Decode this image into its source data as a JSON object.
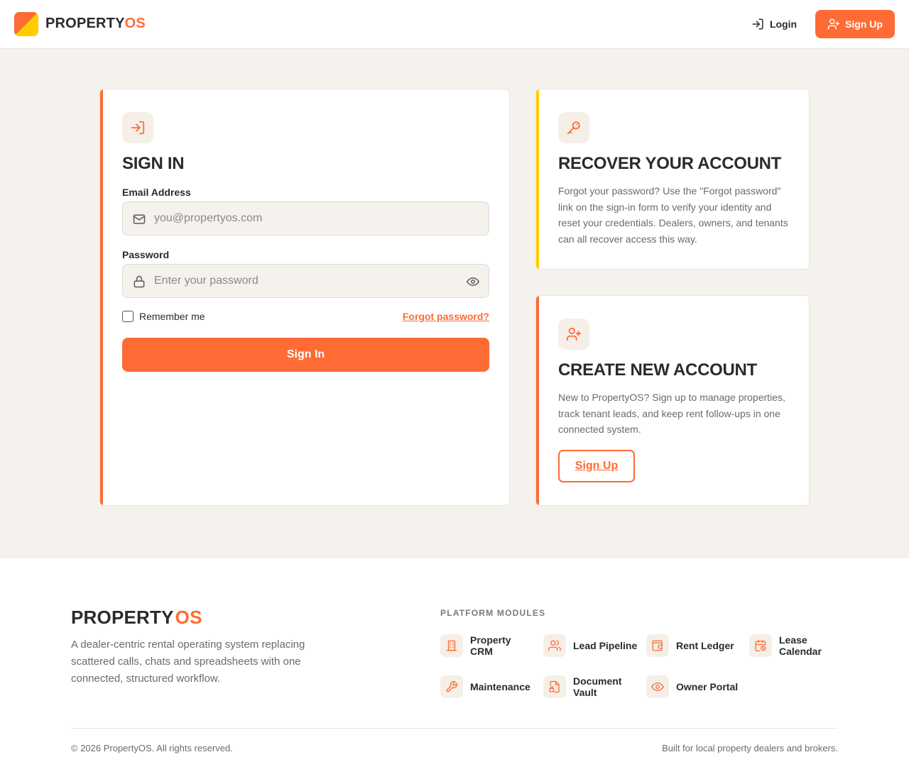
{
  "header": {
    "logo_primary": "PROPERTY",
    "logo_accent": "OS",
    "login_label": "Login",
    "signup_label": "Sign Up"
  },
  "signin": {
    "title": "SIGN IN",
    "email_label": "Email Address",
    "email_placeholder": "you@propertyos.com",
    "password_label": "Password",
    "password_placeholder": "Enter your password",
    "remember_label": "Remember me",
    "forgot_label": "Forgot password?",
    "submit_label": "Sign In"
  },
  "recover": {
    "title": "RECOVER YOUR ACCOUNT",
    "text": "Forgot your password? Use the \"Forgot password\" link on the sign-in form to verify your identity and reset your credentials. Dealers, owners, and tenants can all recover access this way."
  },
  "create": {
    "title": "CREATE NEW ACCOUNT",
    "text": "New to PropertyOS? Sign up to manage properties, track tenant leads, and keep rent follow-ups in one connected system.",
    "button_label": "Sign Up"
  },
  "footer": {
    "logo_primary": "PROPERTY",
    "logo_accent": "OS",
    "description": "A dealer-centric rental operating system replacing scattered calls, chats and spreadsheets with one connected, structured workflow.",
    "modules_heading": "PLATFORM MODULES",
    "modules": [
      {
        "label": "Property CRM",
        "icon": "building-icon"
      },
      {
        "label": "Lead Pipeline",
        "icon": "users-icon"
      },
      {
        "label": "Rent Ledger",
        "icon": "wallet-icon"
      },
      {
        "label": "Lease Calendar",
        "icon": "calendar-clock-icon"
      },
      {
        "label": "Maintenance",
        "icon": "wrench-icon"
      },
      {
        "label": "Document Vault",
        "icon": "file-lock-icon"
      },
      {
        "label": "Owner Portal",
        "icon": "eye-icon"
      }
    ],
    "copyright": "© 2026 PropertyOS. All rights reserved.",
    "tagline": "Built for local property dealers and brokers."
  },
  "colors": {
    "accent": "#ff6b35",
    "secondary_accent": "#ffcc00",
    "page_background": "#f5f2ed",
    "text_dark": "#2b2b2b",
    "text_muted": "#6b6b6b"
  }
}
